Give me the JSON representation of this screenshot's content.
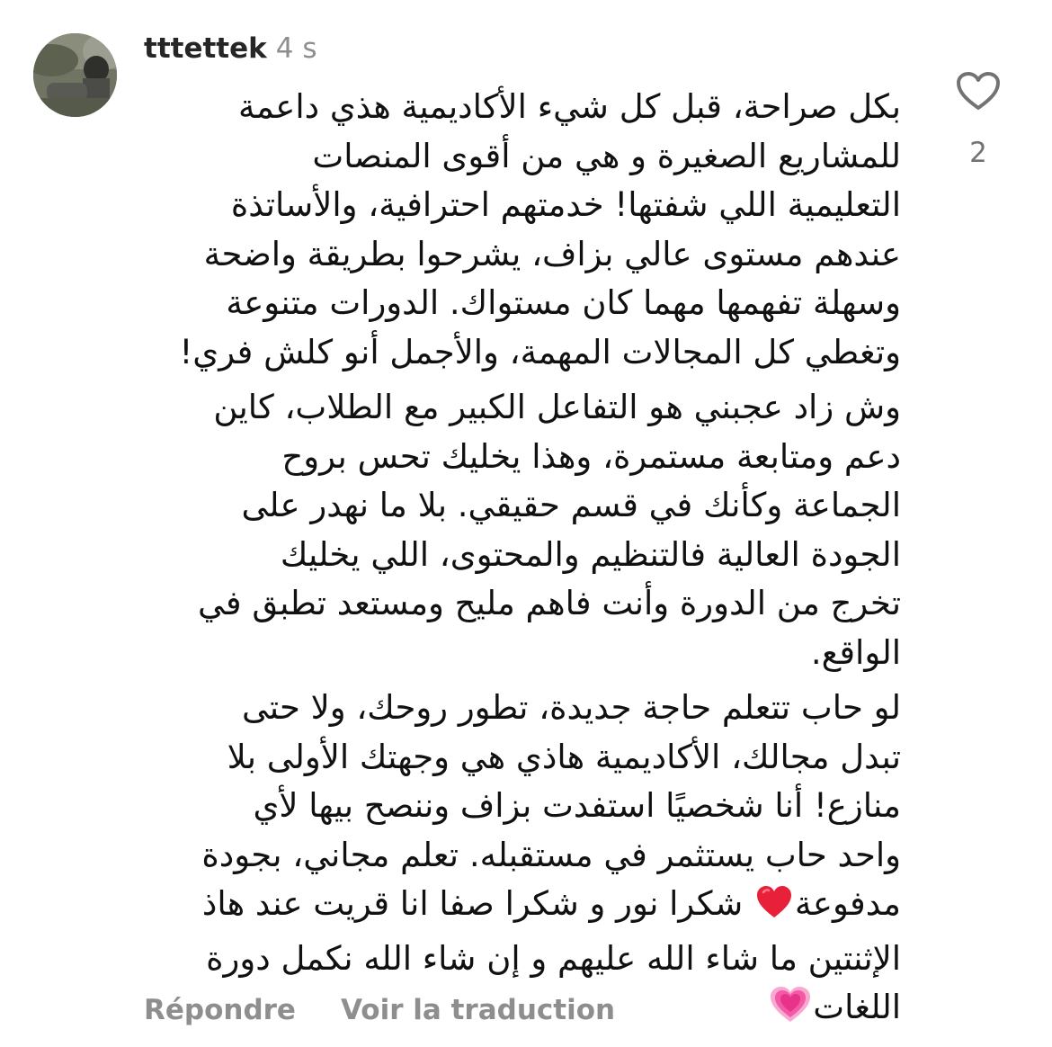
{
  "comment": {
    "username": "tttettek",
    "time": "4 s",
    "likes": "2",
    "paragraphs": [
      [
        "بكل صراحة، قبل كل شيء الأكاديمية هذي داعمة",
        "للمشاريع الصغيرة  و هي من أقوى المنصات",
        "التعليمية اللي شفتها! خدمتهم احترافية، والأساتذة",
        "عندهم مستوى عالي بزاف، يشرحوا بطريقة واضحة",
        "وسهلة تفهمها مهما كان مستواك. الدورات متنوعة",
        "وتغطي كل المجالات المهمة، والأجمل أنو كلش فري!"
      ],
      [
        "وش زاد عجبني هو التفاعل الكبير مع الطلاب، كاين",
        "دعم ومتابعة مستمرة، وهذا يخليك تحس بروح",
        "الجماعة وكأنك في قسم حقيقي. بلا ما نهدر على",
        "الجودة العالية فالتنظيم والمحتوى، اللي يخليك",
        "تخرج من الدورة وأنت فاهم مليح ومستعد تطبق في",
        "الواقع."
      ],
      [
        "لو حاب تتعلم حاجة جديدة، تطور روحك، ولا حتى",
        "تبدل مجالك، الأكاديمية هاذي هي وجهتك الأولى بلا",
        "منازع! أنا شخصيًا استفدت بزاف وننصح بيها لأي",
        "واحد حاب يستثمر في مستقبله. تعلم مجاني، بجودة"
      ]
    ],
    "tail": {
      "line1_before_emoji": "مدفوعة",
      "line1_after_emoji": "شكرا نور و شكرا صفا انا قريت عند هاذ",
      "line2": "الإثنتين  ما شاء الله عليهم و إن شاء الله نكمل دورة",
      "line3": "اللغات"
    },
    "emojis": {
      "red_heart": "red-heart-emoji",
      "growing_heart": "growing-heart-emoji"
    },
    "actions": {
      "reply": "Répondre",
      "translate": "Voir la traduction"
    }
  },
  "colors": {
    "text": "#111111",
    "muted": "#8e8e8e",
    "like_count": "#737373",
    "red_heart": "#e8203a",
    "pink_heart": "#f25aa7"
  }
}
